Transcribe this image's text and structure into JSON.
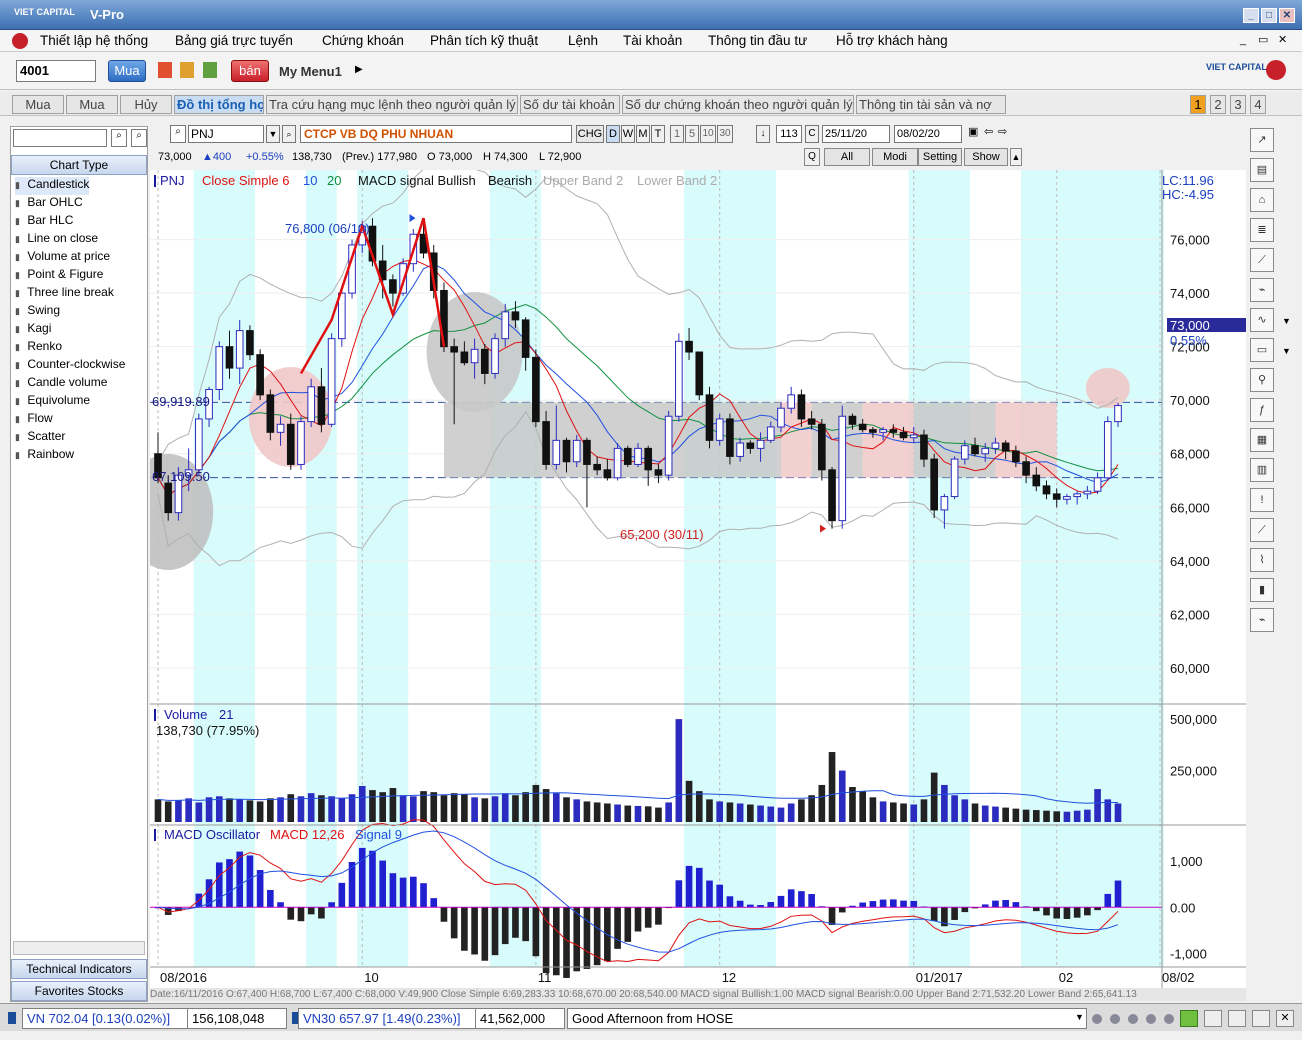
{
  "window": {
    "logo_text": "VIET CAPITAL",
    "title": "V-Pro",
    "min_label": "_",
    "max_label": "□",
    "close_label": "✕",
    "sub_min_label": "_",
    "sub_restore_label": "▭",
    "sub_close_label": "✕"
  },
  "menu": [
    "Thiết lập hệ thống",
    "Bảng giá trực tuyến",
    "Chứng khoán",
    "Phân tích kỹ thuật",
    "Lệnh",
    "Tài khoản",
    "Thông tin đầu tư",
    "Hỗ trợ khách hàng"
  ],
  "toolbar": {
    "account": "4001",
    "buy_label": "Mua",
    "sell_label": "bán",
    "my_menu": "My Menu1",
    "brand": "VIET CAPITAL"
  },
  "tabs": [
    {
      "label": "Mua",
      "active": false
    },
    {
      "label": "Mua",
      "active": false
    },
    {
      "label": "Hủy",
      "active": false
    },
    {
      "label": "Đồ thị tổng hợp",
      "active": true
    },
    {
      "label": "Tra cứu hạng mục lệnh theo người quản lý",
      "active": false
    },
    {
      "label": "Số dư tài khoản",
      "active": false
    },
    {
      "label": "Số dư chứng khoán theo người quản lý",
      "active": false
    },
    {
      "label": "Thông tin tài sản và nợ",
      "active": false
    }
  ],
  "page_buttons": [
    "1",
    "2",
    "3",
    "4"
  ],
  "left_panel": {
    "header": "Chart Type",
    "items": [
      "Candlestick",
      "Bar OHLC",
      "Bar HLC",
      "Line on close",
      "Volume at price",
      "Point & Figure",
      "Three line break",
      "Swing",
      "Kagi",
      "Renko",
      "Counter-clockwise",
      "Candle volume",
      "Equivolume",
      "Flow",
      "Scatter",
      "Rainbow"
    ],
    "btn_tech": "Technical Indicators",
    "btn_fav": "Favorites Stocks"
  },
  "controls": {
    "symbol": "PNJ",
    "company": "CTCP VB DQ PHU NHUAN",
    "periods": [
      "CHG",
      "D",
      "W",
      "M",
      "T",
      "1",
      "5",
      "10",
      "30"
    ],
    "count": "113",
    "from_date": "25/11/20",
    "to_date": "08/02/20",
    "buttons": [
      "All",
      "Modi",
      "Setting",
      "Show"
    ]
  },
  "quote": {
    "price": "73,000",
    "change": "▲400",
    "pct": "+0.55%",
    "volume": "138,730",
    "prev": "(Prev.) 177,980",
    "open": "O 73,000",
    "high": "H 74,300",
    "low": "L 72,900"
  },
  "legend_main": {
    "symbol": "PNJ",
    "close_simple": "Close Simple 6",
    "p10": "10",
    "p20": "20",
    "macd": "MACD signal Bullish",
    "bearish": "Bearish",
    "upper": "Upper Band 2",
    "lower": "Lower Band 2"
  },
  "side_info": {
    "lc": "LC:11.96",
    "hc": "HC:-4.95",
    "price_tag": "73,000",
    "pct_tag": "0.55%"
  },
  "annotations": {
    "high": "76,800 (06/10)",
    "low": "65,200 (30/11)",
    "res": "69,919.89",
    "sup": "67,109.50"
  },
  "volume_legend": {
    "title": "Volume",
    "period": "21",
    "value": "138,730 (77.95%)"
  },
  "macd_legend": {
    "title": "MACD Oscillator",
    "macd": "MACD 12,26",
    "signal": "Signal 9"
  },
  "data_line": "Date:16/11/2016 O:67,400 H:68,700 L:67,400 C:68,000 V:49,900 Close Simple 6:69,283.33 10:68,670.00 20:68,540.00 MACD signal Bullish:1.00 MACD signal Bearish:0.00 Upper Band 2:71,532.20 Lower Band 2:65,641.13",
  "status": {
    "vn": "VN 702.04 [0.13(0.02%)]",
    "vn_vol": "156,108,048",
    "vn30": "VN30 657.97 [1.49(0.23%)]",
    "vn30_vol": "41,562,000",
    "msg": "Good Afternoon from HOSE"
  },
  "colors": {
    "up": "#2b2bbf",
    "down": "#111111",
    "ma6": "#e01010",
    "ma10": "#2050e0",
    "ma20": "#109040",
    "band": "#b0b0b0",
    "cyan": "#d8fcfc",
    "zone": "#f0c8c8"
  },
  "chart_data": {
    "type": "candlestick",
    "symbol": "PNJ",
    "x_labels": [
      {
        "i": 0,
        "label": "08/2016"
      },
      {
        "i": 20,
        "label": "10"
      },
      {
        "i": 37,
        "label": "11"
      },
      {
        "i": 55,
        "label": "12"
      },
      {
        "i": 74,
        "label": "01/2017"
      },
      {
        "i": 88,
        "label": "02"
      },
      {
        "i": 98,
        "label": "08/02"
      }
    ],
    "price_ticks": [
      60000,
      62000,
      64000,
      66000,
      68000,
      70000,
      72000,
      74000,
      76000
    ],
    "ylim": [
      58800,
      78600
    ],
    "volume_ticks": [
      {
        "v": 250000,
        "label": "250,000"
      },
      {
        "v": 500000,
        "label": "500,000"
      }
    ],
    "volume_max": 520000,
    "macd_ticks": [
      {
        "v": 1000,
        "label": "1,000"
      },
      {
        "v": 0,
        "label": "0.00"
      },
      {
        "v": -1000,
        "label": "-1,000"
      }
    ],
    "macd_lim": [
      -1250,
      1500
    ],
    "n": 95,
    "ohlc": [
      [
        68000,
        68800,
        66900,
        67100
      ],
      [
        66900,
        67200,
        65500,
        65800
      ],
      [
        65800,
        67500,
        65500,
        67200
      ],
      [
        67200,
        68200,
        66600,
        67400
      ],
      [
        67400,
        69500,
        67200,
        69300
      ],
      [
        69300,
        70500,
        69000,
        70400
      ],
      [
        70400,
        72200,
        70000,
        72000
      ],
      [
        72000,
        72600,
        70800,
        71200
      ],
      [
        71200,
        73000,
        70600,
        72600
      ],
      [
        72600,
        72800,
        71500,
        71700
      ],
      [
        71700,
        71900,
        70000,
        70200
      ],
      [
        70200,
        70400,
        68500,
        68800
      ],
      [
        68800,
        69400,
        68300,
        69100
      ],
      [
        69100,
        69500,
        67400,
        67600
      ],
      [
        67600,
        69400,
        67400,
        69200
      ],
      [
        69200,
        70800,
        69000,
        70500
      ],
      [
        70500,
        71200,
        68800,
        69100
      ],
      [
        69100,
        72500,
        69000,
        72300
      ],
      [
        72300,
        74200,
        72000,
        74000
      ],
      [
        74000,
        76000,
        73800,
        75800
      ],
      [
        75800,
        76700,
        75500,
        76500
      ],
      [
        76500,
        76800,
        75000,
        75200
      ],
      [
        75200,
        75800,
        73800,
        74500
      ],
      [
        74500,
        74700,
        73500,
        74000
      ],
      [
        74000,
        75300,
        73900,
        75100
      ],
      [
        75100,
        76400,
        74800,
        76200
      ],
      [
        76200,
        76800,
        75300,
        75500
      ],
      [
        75500,
        75800,
        73800,
        74100
      ],
      [
        74100,
        74400,
        71800,
        72000
      ],
      [
        72000,
        72300,
        69100,
        71800
      ],
      [
        71800,
        72200,
        71300,
        71400
      ],
      [
        71400,
        72300,
        70800,
        71900
      ],
      [
        71900,
        72100,
        70600,
        71000
      ],
      [
        71000,
        72500,
        70800,
        72300
      ],
      [
        72300,
        73600,
        72000,
        73300
      ],
      [
        73300,
        73700,
        72700,
        73000
      ],
      [
        73000,
        73100,
        71100,
        71600
      ],
      [
        71600,
        71900,
        69000,
        69200
      ],
      [
        69200,
        69600,
        67400,
        67600
      ],
      [
        67600,
        69800,
        67400,
        68500
      ],
      [
        68500,
        68600,
        67300,
        67700
      ],
      [
        67700,
        68700,
        67500,
        68500
      ],
      [
        68500,
        68600,
        66000,
        67600
      ],
      [
        67600,
        67900,
        67200,
        67400
      ],
      [
        67400,
        67800,
        67000,
        67100
      ],
      [
        67100,
        68400,
        67000,
        68200
      ],
      [
        68200,
        68300,
        67500,
        67600
      ],
      [
        67600,
        68400,
        67500,
        68200
      ],
      [
        68200,
        68300,
        66800,
        67400
      ],
      [
        67400,
        67600,
        66900,
        67200
      ],
      [
        67200,
        69600,
        67000,
        69400
      ],
      [
        69400,
        72500,
        69200,
        72200
      ],
      [
        72200,
        72700,
        71500,
        71800
      ],
      [
        71800,
        71800,
        70000,
        70200
      ],
      [
        70200,
        70500,
        68200,
        68500
      ],
      [
        68500,
        69500,
        68300,
        69300
      ],
      [
        69300,
        69500,
        67600,
        67900
      ],
      [
        67900,
        68600,
        67700,
        68400
      ],
      [
        68400,
        68500,
        68000,
        68200
      ],
      [
        68200,
        68800,
        67700,
        68500
      ],
      [
        68500,
        69200,
        68400,
        69000
      ],
      [
        69000,
        69900,
        68800,
        69700
      ],
      [
        69700,
        70500,
        69500,
        70200
      ],
      [
        70200,
        70400,
        69000,
        69300
      ],
      [
        69300,
        69600,
        68900,
        69100
      ],
      [
        69100,
        69300,
        67000,
        67400
      ],
      [
        67400,
        67500,
        65200,
        65500
      ],
      [
        65500,
        69800,
        65200,
        69400
      ],
      [
        69400,
        69500,
        68900,
        69100
      ],
      [
        69100,
        69300,
        68800,
        68900
      ],
      [
        68900,
        69000,
        68600,
        68800
      ],
      [
        68800,
        69000,
        68500,
        68900
      ],
      [
        68900,
        69100,
        68600,
        68800
      ],
      [
        68800,
        69000,
        68500,
        68600
      ],
      [
        68600,
        69000,
        68400,
        68700
      ],
      [
        68700,
        68900,
        67500,
        67800
      ],
      [
        67800,
        68000,
        65600,
        65900
      ],
      [
        65900,
        66500,
        65200,
        66400
      ],
      [
        66400,
        67900,
        66300,
        67800
      ],
      [
        67800,
        68500,
        67600,
        68300
      ],
      [
        68300,
        68600,
        67900,
        68000
      ],
      [
        68000,
        68400,
        67700,
        68200
      ],
      [
        68200,
        68600,
        68000,
        68400
      ],
      [
        68400,
        68500,
        67800,
        68100
      ],
      [
        68100,
        68300,
        67500,
        67700
      ],
      [
        67700,
        67900,
        66900,
        67200
      ],
      [
        67200,
        67500,
        66600,
        66800
      ],
      [
        66800,
        67000,
        66300,
        66500
      ],
      [
        66500,
        66700,
        66000,
        66300
      ],
      [
        66300,
        66500,
        66100,
        66400
      ],
      [
        66400,
        66600,
        66100,
        66500
      ],
      [
        66500,
        66800,
        66300,
        66600
      ],
      [
        66600,
        67300,
        66500,
        67100
      ],
      [
        67100,
        69400,
        67000,
        69200
      ],
      [
        69200,
        69900,
        69000,
        69800
      ],
      [
        69800,
        69900,
        69300,
        69600
      ],
      [
        69600,
        69800,
        69200,
        69400
      ],
      [
        69400,
        69500,
        68900,
        69100
      ],
      [
        69100,
        69200,
        68300,
        68500
      ],
      [
        68500,
        69100,
        68400,
        68900
      ],
      [
        68900,
        69100,
        68500,
        68800
      ],
      [
        68800,
        69200,
        68600,
        69000
      ],
      [
        69000,
        69300,
        68700,
        68900
      ],
      [
        68900,
        69000,
        68600,
        68800
      ],
      [
        68800,
        69200,
        68400,
        69000
      ],
      [
        69000,
        69100,
        67100,
        68700
      ],
      [
        68700,
        70500,
        68600,
        70100
      ],
      [
        70100,
        71200,
        69900,
        71000
      ],
      [
        71000,
        72300,
        70800,
        72100
      ],
      [
        72100,
        74300,
        72000,
        73000
      ]
    ],
    "volume": [
      110000,
      100000,
      105000,
      115000,
      95000,
      120000,
      125000,
      115000,
      110000,
      105000,
      100000,
      115000,
      120000,
      135000,
      125000,
      140000,
      130000,
      125000,
      115000,
      135000,
      175000,
      155000,
      145000,
      165000,
      130000,
      125000,
      150000,
      145000,
      130000,
      140000,
      135000,
      120000,
      115000,
      125000,
      140000,
      130000,
      145000,
      180000,
      160000,
      140000,
      120000,
      110000,
      100000,
      95000,
      90000,
      85000,
      80000,
      78000,
      76000,
      70000,
      95000,
      500000,
      200000,
      150000,
      110000,
      100000,
      95000,
      90000,
      85000,
      80000,
      75000,
      70000,
      90000,
      110000,
      130000,
      180000,
      340000,
      250000,
      170000,
      150000,
      120000,
      100000,
      95000,
      90000,
      85000,
      110000,
      240000,
      180000,
      130000,
      110000,
      90000,
      80000,
      75000,
      70000,
      65000,
      60000,
      58000,
      55000,
      52000,
      50000,
      55000,
      60000,
      160000,
      110000,
      90000,
      80000,
      75000,
      70000,
      68000,
      65000,
      60000,
      58000,
      62000,
      65000,
      70000,
      100000,
      195000,
      185000,
      145000
    ],
    "zones_cyan": [
      [
        4,
        9
      ],
      [
        15,
        17
      ],
      [
        20,
        24
      ],
      [
        33,
        37
      ],
      [
        52,
        60
      ],
      [
        74,
        79
      ],
      [
        85,
        89
      ],
      [
        90,
        98
      ]
    ],
    "resistance": 69919.89,
    "support": 67109.5,
    "high_point": {
      "i": 26,
      "value": 76800,
      "label": "76,800 (06/10)"
    },
    "low_point": {
      "i": 66,
      "value": 65200,
      "label": "65,200 (30/11)"
    }
  }
}
